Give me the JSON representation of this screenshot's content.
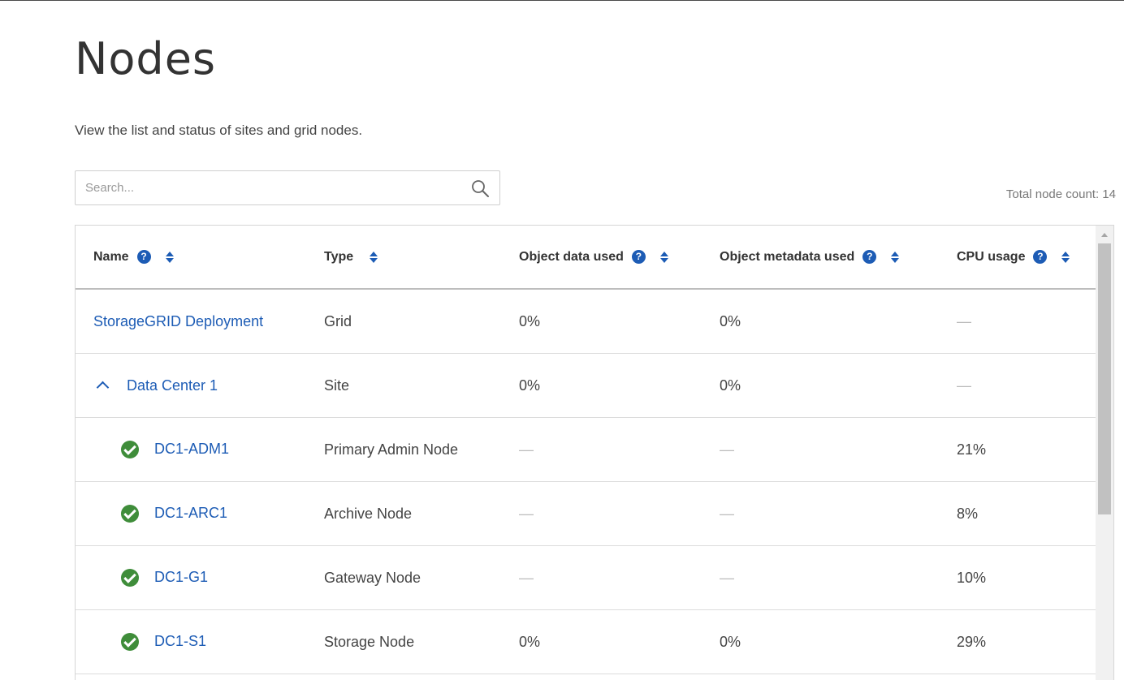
{
  "page": {
    "title": "Nodes",
    "subtitle": "View the list and status of sites and grid nodes.",
    "total_node_count": "Total node count: 14"
  },
  "search": {
    "placeholder": "Search...",
    "value": ""
  },
  "table": {
    "headers": {
      "name": "Name",
      "type": "Type",
      "object_data": "Object data used",
      "object_metadata": "Object metadata used",
      "cpu": "CPU usage"
    },
    "rows": [
      {
        "name": "StorageGRID Deployment",
        "type": "Grid",
        "object_data": "0%",
        "object_metadata": "0%",
        "cpu": "—"
      },
      {
        "name": "Data Center 1",
        "type": "Site",
        "object_data": "0%",
        "object_metadata": "0%",
        "cpu": "—"
      },
      {
        "name": "DC1-ADM1",
        "type": "Primary Admin Node",
        "object_data": "—",
        "object_metadata": "—",
        "cpu": "21%"
      },
      {
        "name": "DC1-ARC1",
        "type": "Archive Node",
        "object_data": "—",
        "object_metadata": "—",
        "cpu": "8%"
      },
      {
        "name": "DC1-G1",
        "type": "Gateway Node",
        "object_data": "—",
        "object_metadata": "—",
        "cpu": "10%"
      },
      {
        "name": "DC1-S1",
        "type": "Storage Node",
        "object_data": "0%",
        "object_metadata": "0%",
        "cpu": "29%"
      }
    ]
  },
  "icons": {
    "search": "search-icon",
    "help": "question-circle-icon",
    "sort": "sort-icon",
    "status_ok": "check-circle-icon",
    "collapse": "chevron-up-icon"
  },
  "colors": {
    "link": "#1d5cb5",
    "status_ok": "#3f8d3a",
    "help_icon": "#1d5cb5"
  }
}
